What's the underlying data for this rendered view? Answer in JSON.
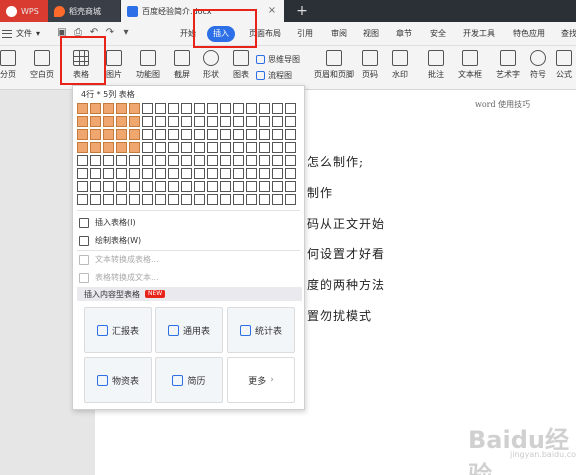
{
  "tabs": {
    "wps": "WPS",
    "shop": "稻壳商城",
    "doc": "百度经验简介.docx",
    "close": "×",
    "add": "+"
  },
  "menu": {
    "file": "文件",
    "items": [
      "开始",
      "插入",
      "页面布局",
      "引用",
      "审阅",
      "视图",
      "章节",
      "安全",
      "开发工具",
      "特色应用",
      "查找"
    ]
  },
  "ribbon": {
    "page_break": "分页",
    "blank_page": "空白页",
    "table": "表格",
    "picture": "图片",
    "func_chart": "功能图",
    "screenshot": "截屏",
    "shape": "形状",
    "chart": "图表",
    "mindmap": "思维导图",
    "flowchart": "流程图",
    "header_footer": "页眉和页脚",
    "page_number": "页码",
    "watermark": "水印",
    "comment": "批注",
    "text_box": "文本框",
    "art_text": "艺术字",
    "symbol": "符号",
    "formula": "公式"
  },
  "document": {
    "header": "word 使用技巧",
    "lines": [
      "怎么制作;",
      "制作",
      "码从正文开始",
      "何设置才好看",
      "度的两种方法",
      "置勿扰模式"
    ]
  },
  "dropdown": {
    "grid_label": "4行 * 5列 表格",
    "grid_rows": 8,
    "grid_cols": 17,
    "selected_rows": 4,
    "selected_cols": 5,
    "insert_table": "插入表格(I)",
    "draw_table": "绘制表格(W)",
    "text_to_table": "文本转换成表格...",
    "table_to_text": "表格转换成文本...",
    "section_title": "插入内容型表格",
    "section_badge": "NEW",
    "cards": {
      "report": "汇报表",
      "general": "通用表",
      "stats": "统计表",
      "materials": "物资表",
      "resume": "简历",
      "more": "更多"
    }
  },
  "watermark": {
    "brand": "Baidu经验",
    "url": "jingyan.baidu.com"
  },
  "colors": {
    "accent": "#2d6fe6",
    "highlight_box": "#e8231a",
    "grid_selected": "#f0a66f"
  }
}
